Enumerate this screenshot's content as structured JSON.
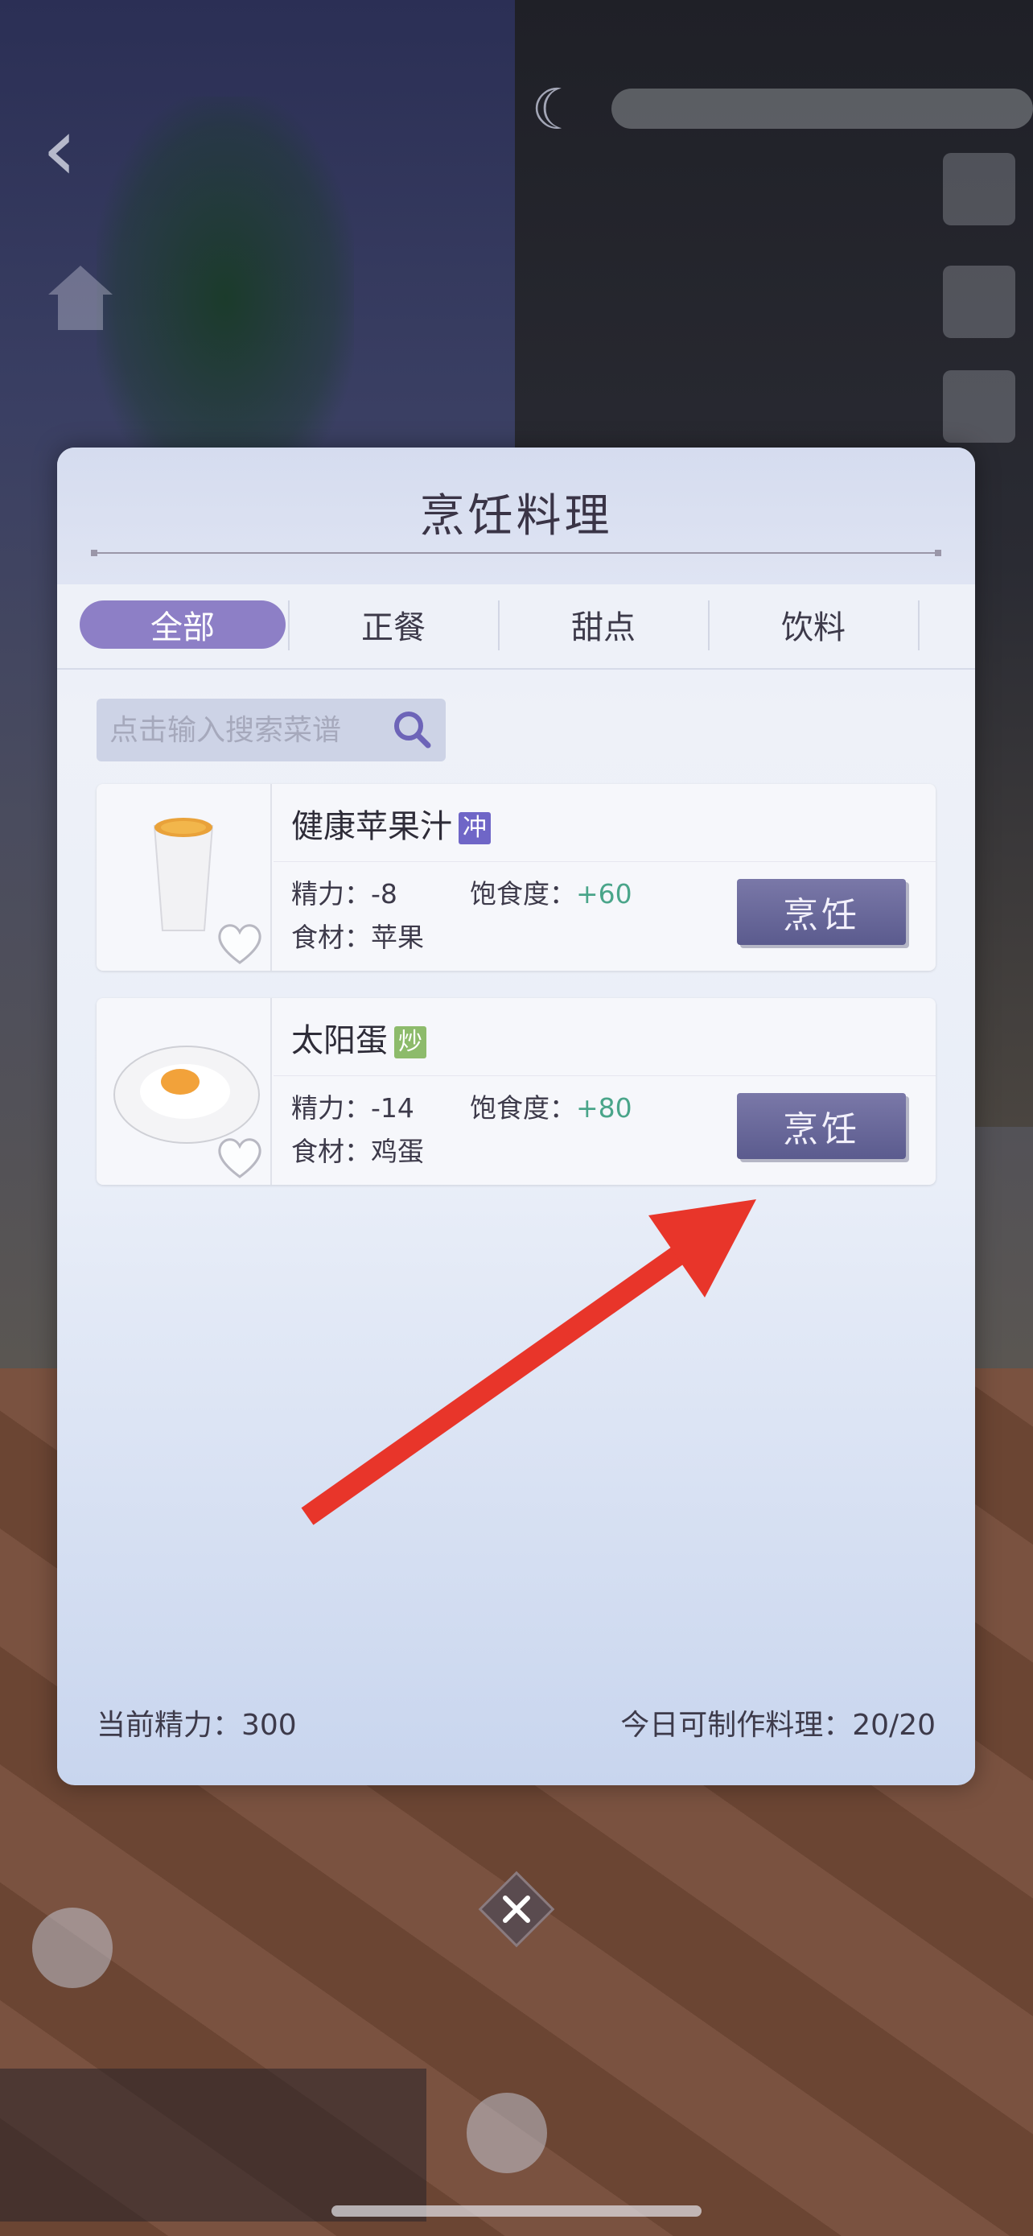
{
  "panel": {
    "title": "烹饪料理",
    "tabs": [
      {
        "label": "全部",
        "active": true
      },
      {
        "label": "正餐",
        "active": false
      },
      {
        "label": "甜点",
        "active": false
      },
      {
        "label": "饮料",
        "active": false
      }
    ],
    "search": {
      "placeholder": "点击输入搜索菜谱",
      "value": ""
    },
    "recipes": [
      {
        "name": "健康苹果汁",
        "badge": "冲",
        "energy_label": "精力：",
        "energy_value": "-8",
        "satiety_label": "饱食度：",
        "satiety_value": "+60",
        "ingredient_label": "食材：",
        "ingredient_value": "苹果",
        "cook_label": "烹饪"
      },
      {
        "name": "太阳蛋",
        "badge": "炒",
        "energy_label": "精力：",
        "energy_value": "-14",
        "satiety_label": "饱食度：",
        "satiety_value": "+80",
        "ingredient_label": "食材：",
        "ingredient_value": "鸡蛋",
        "cook_label": "烹饪"
      }
    ],
    "footer": {
      "energy_text": "当前精力：300",
      "daily_text": "今日可制作料理：20/20"
    }
  },
  "colors": {
    "accent_tab": "#8d7fc6",
    "cook_button": "#5b5b8e",
    "positive": "#4aa58a",
    "annotation_arrow": "#e8352a"
  },
  "icons": [
    "back-chevron-icon",
    "moon-icon",
    "home-icon",
    "search-icon",
    "heart-icon",
    "close-icon"
  ]
}
